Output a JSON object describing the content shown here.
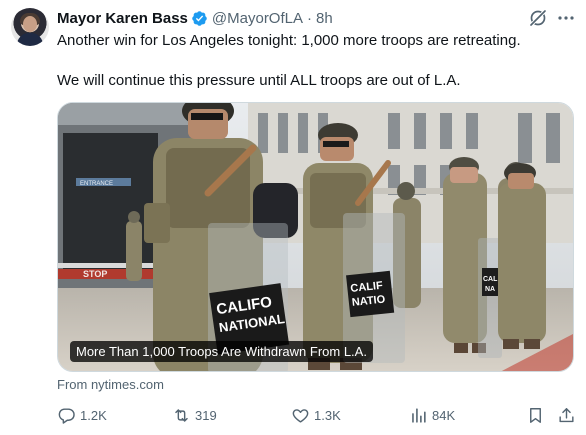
{
  "author": {
    "name": "Mayor Karen Bass",
    "handle": "@MayorOfLA",
    "separator": "·",
    "time": "8h"
  },
  "tweet": {
    "paragraphs": [
      "Another win for Los Angeles tonight: 1,000 more troops are retreating.",
      "We will continue this pressure until ALL troops are out of L.A."
    ]
  },
  "card": {
    "caption": "More Than 1,000 Troops Are Withdrawn From L.A.",
    "source": "From nytimes.com",
    "image_texts": {
      "shield_left": [
        "CALIFO",
        "NATIONAL"
      ],
      "shield_mid": [
        "CALIF",
        "NATIO"
      ],
      "shield_right": [
        "CAL",
        "NA"
      ],
      "sign_stop": "STOP",
      "sign_entrance": "ENTRANCE"
    }
  },
  "actions": {
    "reply_count": "1.2K",
    "retweet_count": "319",
    "like_count": "1.3K",
    "views_count": "84K"
  },
  "colors": {
    "text_primary": "#0f1419",
    "text_secondary": "#536471",
    "verified_blue": "#1d9bf0"
  },
  "icons": [
    "verified-icon",
    "grok-icon",
    "more-icon",
    "reply-icon",
    "retweet-icon",
    "like-icon",
    "views-icon",
    "bookmark-icon",
    "share-icon"
  ]
}
